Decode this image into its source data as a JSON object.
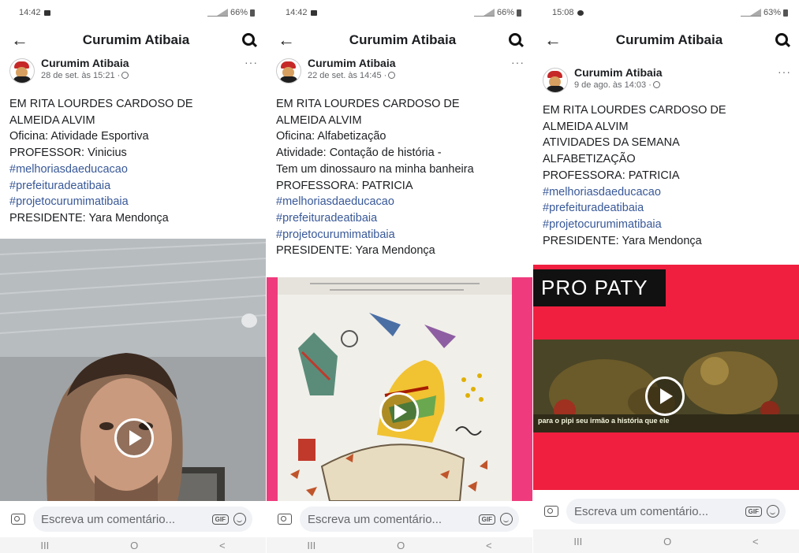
{
  "panels": [
    {
      "status_time": "14:42",
      "battery_text": "66%",
      "app_title": "Curumim Atibaia",
      "author": "Curumim Atibaia",
      "date": "28 de set. às 15:21 ·",
      "lines": [
        {
          "text": "EM RITA LOURDES CARDOSO DE",
          "tag": false
        },
        {
          "text": "ALMEIDA ALVIM",
          "tag": false
        },
        {
          "text": "Oficina: Atividade Esportiva",
          "tag": false
        },
        {
          "text": "PROFESSOR: Vinicius",
          "tag": false
        },
        {
          "text": "#melhoriasdaeducacao",
          "tag": true
        },
        {
          "text": "#prefeituradeatibaia",
          "tag": true
        },
        {
          "text": "#projetocurumimatibaia",
          "tag": true
        },
        {
          "text": "PRESIDENTE: Yara Mendonça",
          "tag": false
        }
      ],
      "video_overlay": ""
    },
    {
      "status_time": "14:42",
      "battery_text": "66%",
      "app_title": "Curumim Atibaia",
      "author": "Curumim Atibaia",
      "date": "22 de set. às 14:45 ·",
      "lines": [
        {
          "text": "EM RITA LOURDES CARDOSO DE",
          "tag": false
        },
        {
          "text": "ALMEIDA ALVIM",
          "tag": false
        },
        {
          "text": "Oficina: Alfabetização",
          "tag": false
        },
        {
          "text": "Atividade: Contação de história -",
          "tag": false
        },
        {
          "text": "Tem um dinossauro na minha banheira",
          "tag": false
        },
        {
          "text": "PROFESSORA: PATRICIA",
          "tag": false
        },
        {
          "text": "#melhoriasdaeducacao",
          "tag": true
        },
        {
          "text": "#prefeituradeatibaia",
          "tag": true
        },
        {
          "text": "#projetocurumimatibaia",
          "tag": true
        },
        {
          "text": "PRESIDENTE: Yara Mendonça",
          "tag": false
        }
      ],
      "video_overlay": ""
    },
    {
      "status_time": "15:08",
      "battery_text": "63%",
      "app_title": "Curumim Atibaia",
      "author": "Curumim Atibaia",
      "date": "9 de ago. às 14:03 ·",
      "lines": [
        {
          "text": "EM RITA LOURDES CARDOSO DE",
          "tag": false
        },
        {
          "text": "ALMEIDA ALVIM",
          "tag": false
        },
        {
          "text": "ATIVIDADES DA SEMANA",
          "tag": false
        },
        {
          "text": "ALFABETIZAÇÃO",
          "tag": false
        },
        {
          "text": "PROFESSORA: PATRICIA",
          "tag": false
        },
        {
          "text": "#melhoriasdaeducacao",
          "tag": true
        },
        {
          "text": "#prefeituradeatibaia",
          "tag": true
        },
        {
          "text": "#projetocurumimatibaia",
          "tag": true
        },
        {
          "text": "PRESIDENTE: Yara Mendonça",
          "tag": false
        }
      ],
      "video_overlay": "PRO PATY",
      "video_caption": "para o pipi seu irmão a história que ele"
    }
  ],
  "comment_placeholder": "Escreva um comentário...",
  "gif_label": "GIF",
  "nav": [
    "III",
    "O",
    "<"
  ],
  "colors": {
    "hashtag": "#385898",
    "pink_frame": "#ef3b7d",
    "red_frame": "#f01f3f"
  }
}
